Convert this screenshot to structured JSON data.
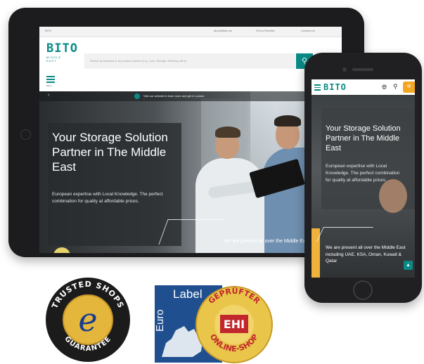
{
  "tablet": {
    "topbar": {
      "left_text": "BITO",
      "link1": "about@bito.ae",
      "link2": "Find a Reseller",
      "link3": "Contact Us"
    },
    "logo": {
      "word": "BITO",
      "sub": "MIDDLE EAST"
    },
    "search": {
      "placeholder": "Search by keyword or by product number (e.g. Lock, Storage, Shelving, Bins)"
    },
    "menu_label": "Menu",
    "info_bar": "Visit our website to learn more and get in contact",
    "hero": {
      "title": "Your Storage Solution Partner in The Middle East",
      "description": "European expertise with Local Knowledge. The perfect combination for quality at affordable prices.",
      "present": "We are present all over the Middle East"
    }
  },
  "phone": {
    "logo": "BITO",
    "hero": {
      "title": "Your Storage Solution Partner in The Middle East",
      "description": "European expertise with Local Knowledge. The perfect combination for quality at affordable prices.",
      "present": "We are present all over the Middle East including UAE, KSA, Oman, Kuwait & Qatar"
    }
  },
  "badges": {
    "trusted_shops": {
      "top": "TRUSTED SHOPS",
      "bottom": "GUARANTEE",
      "letter": "e"
    },
    "ehi": {
      "label": "Label",
      "euro": "Euro",
      "ring_top": "GEPRÜFTER",
      "ring_bottom": "ONLINE-SHOP",
      "center": "EHI"
    }
  },
  "colors": {
    "brand": "#0a8a86",
    "accent": "#f3a622",
    "badge_gold": "#e4b73c",
    "ehi_blue": "#1f4f8f"
  }
}
